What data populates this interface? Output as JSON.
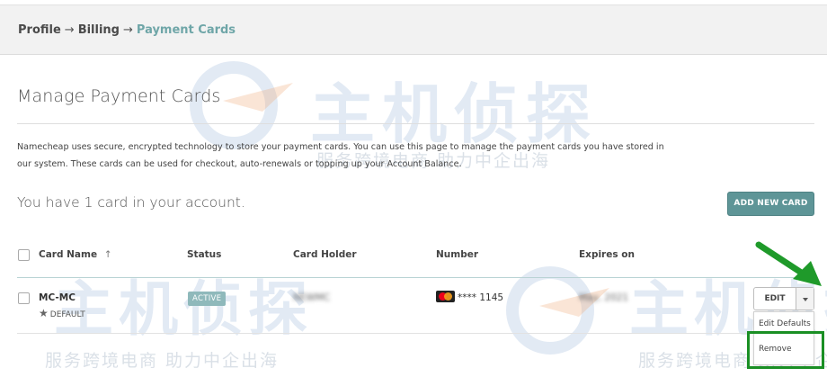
{
  "breadcrumb": {
    "items": [
      "Profile",
      "Billing"
    ],
    "current": "Payment Cards",
    "separator": "→"
  },
  "page": {
    "title": "Manage Payment Cards",
    "description": "Namecheap uses secure, encrypted technology to store your payment cards. You can use this page to manage the payment cards you have stored in our system. These cards can be used for checkout, auto-renewals or topping up your Account Balance.",
    "count_text": "You have 1 card in your account."
  },
  "actions": {
    "add_new_card": "ADD NEW CARD"
  },
  "table": {
    "columns": {
      "card_name": "Card Name",
      "sort_indicator": "↑",
      "status": "Status",
      "card_holder": "Card Holder",
      "number": "Number",
      "expires_on": "Expires on"
    },
    "rows": [
      {
        "card_name": "MC-MC",
        "default_label": "DEFAULT",
        "status": "ACTIVE",
        "card_holder": "NEWMC",
        "number": "**** 1145",
        "expires": "May, 2021",
        "brand_icon": "mastercard-icon"
      }
    ]
  },
  "row_actions": {
    "edit": "EDIT",
    "menu": [
      "Edit Defaults",
      "Remove"
    ]
  },
  "watermark": {
    "title": "主机侦探",
    "subtitle": "服务跨境电商 助力中企出海"
  },
  "colors": {
    "accent": "#5e9597",
    "breadcrumb_current": "#6fa6a8",
    "highlight": "#1a8f24",
    "status_badge": "#8fb9bb"
  }
}
